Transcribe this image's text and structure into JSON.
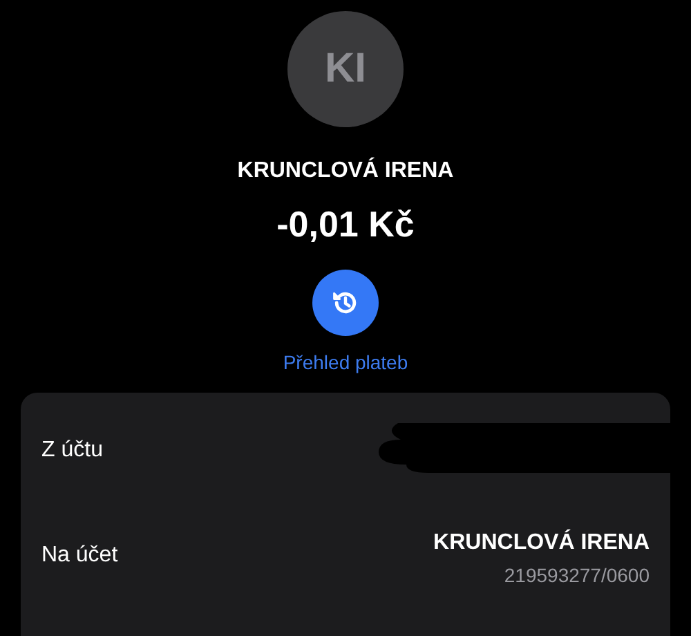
{
  "avatar": {
    "initials": "KI"
  },
  "name": "KRUNCLOVÁ IRENA",
  "amount": "-0,01 Kč",
  "history_button": {
    "label": "Přehled plateb"
  },
  "details": [
    {
      "kind": "redacted",
      "label": "Z účtu"
    },
    {
      "kind": "account",
      "label": "Na účet",
      "name": "KRUNCLOVÁ IRENA",
      "number": "219593277/0600"
    }
  ]
}
